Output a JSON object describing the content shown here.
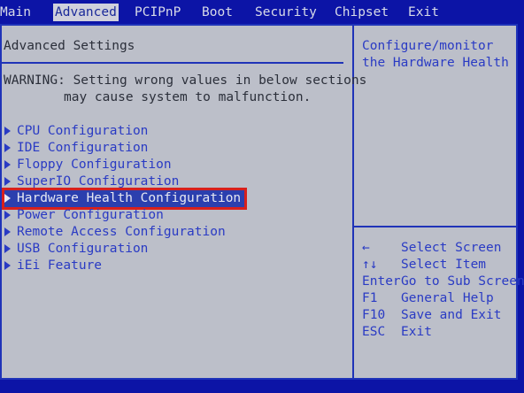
{
  "menu": [
    "Main",
    "Advanced",
    "PCIPnP",
    "Boot",
    "Security",
    "Chipset",
    "Exit"
  ],
  "active_tab": "Advanced",
  "main": {
    "title": "Advanced Settings",
    "warning_line1": "WARNING: Setting wrong values in below sections",
    "warning_line2": "may cause system to malfunction.",
    "items": [
      "CPU Configuration",
      "IDE Configuration",
      "Floppy Configuration",
      "SuperIO Configuration",
      "Hardware Health Configuration",
      "Power Configuration",
      "Remote Access Configuration",
      "USB Configuration",
      "iEi Feature"
    ],
    "selected_item": "Hardware Health Configuration"
  },
  "help": {
    "line1": "Configure/monitor",
    "line2": "the Hardware Health"
  },
  "keys": [
    {
      "key": "←",
      "desc": "Select Screen"
    },
    {
      "key": "↑↓",
      "desc": "Select Item"
    },
    {
      "key": "Enter",
      "desc": "Go to Sub Screen"
    },
    {
      "key": "F1",
      "desc": "General Help"
    },
    {
      "key": "F10",
      "desc": "Save and Exit"
    },
    {
      "key": "ESC",
      "desc": "Exit"
    }
  ],
  "colors": {
    "background": "#0c14a6",
    "panel": "#bcbfc9",
    "accent": "#2a3bc4",
    "highlight_border": "#d8201c"
  }
}
